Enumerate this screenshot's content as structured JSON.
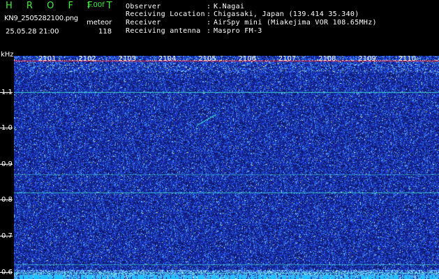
{
  "header": {
    "app_title": "H R O F F T",
    "version": "1.00f",
    "filename": "KN9_2505282100.png",
    "mode": "meteor",
    "timestamp": "25.05.28 21:00",
    "count": "118"
  },
  "info": [
    {
      "label": "Observer",
      "value": "K.Nagai"
    },
    {
      "label": "Receiving Location",
      "value": "Chigasaki, Japan (139.414 35.340)"
    },
    {
      "label": "Receiver",
      "value": "AirSpy mini (Miakejima VOR 108.65MHz)"
    },
    {
      "label": "Receiving antenna",
      "value": "Maspro FM-3"
    }
  ],
  "axis": {
    "unit": "kHz",
    "y_ticks": [
      "1.1",
      "1.0",
      "0.9",
      "0.8",
      "0.7",
      "0.6"
    ],
    "y_values": [
      1.1,
      1.0,
      0.9,
      0.8,
      0.7,
      0.6
    ],
    "y_range": [
      0.58,
      1.2
    ],
    "time_ticks": [
      "2101",
      "2102",
      "2103",
      "2104",
      "2105",
      "2106",
      "2107",
      "2108",
      "2109",
      "2110"
    ]
  },
  "colors": {
    "background": "#000000",
    "noise_dark": "#101a6a",
    "noise_mid": "#1c34c8",
    "noise_light": "#3aa0ff",
    "carrier": "#40e0d0",
    "title": "#3ef03e",
    "time_marker": "#ff3030"
  }
}
